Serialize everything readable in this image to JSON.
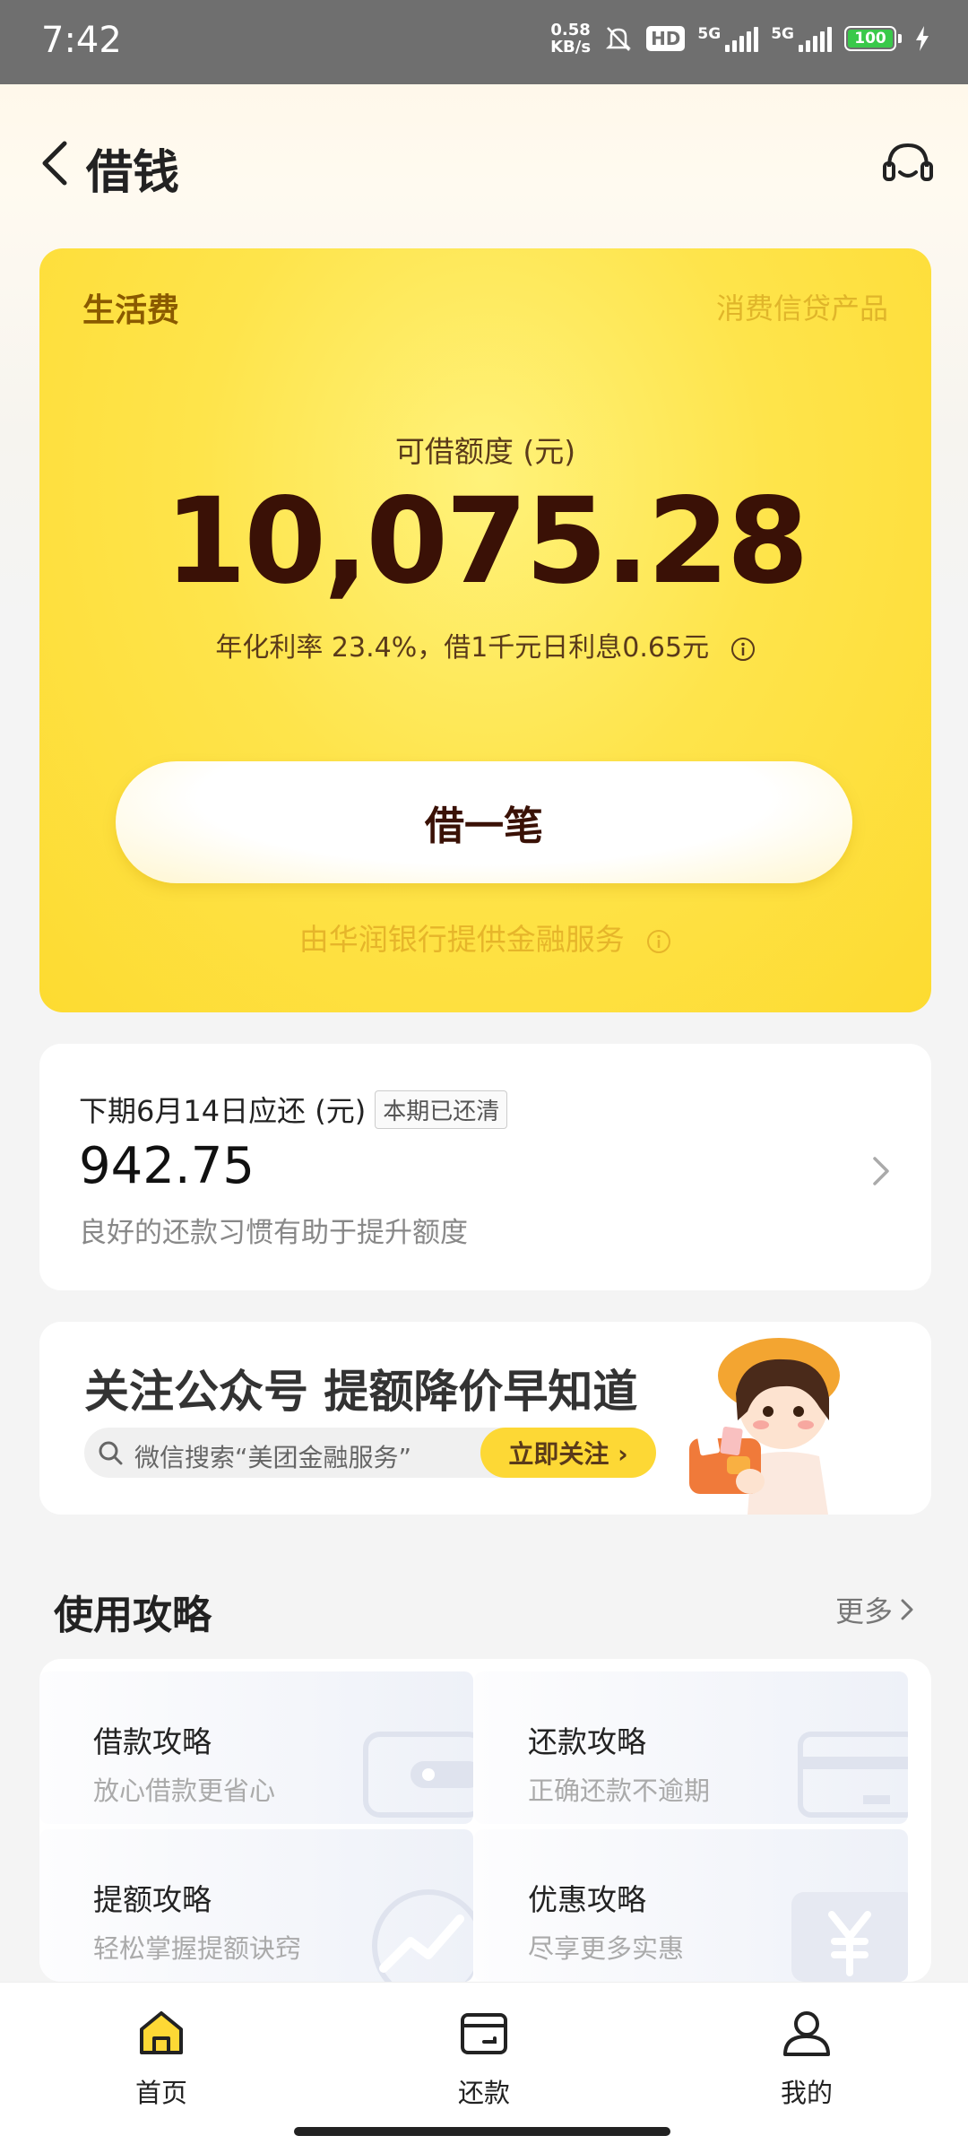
{
  "status_bar": {
    "time": "7:42",
    "net_speed_value": "0.58",
    "net_speed_unit": "KB/s",
    "hd_label": "HD",
    "sim1_label": "5G",
    "sim2_label": "5G",
    "battery": "100",
    "battery_color": "#39c94a"
  },
  "header": {
    "title": "借钱",
    "back_icon": "chevron-left-icon",
    "service_icon": "headset-icon"
  },
  "loan_card": {
    "label": "生活费",
    "product_type": "消费信贷产品",
    "quota_label": "可借额度 (元)",
    "quota_amount": "10,075.28",
    "rate_text": "年化利率 23.4%，借1千元日利息0.65元",
    "borrow_button": "借一笔",
    "bank_text": "由华润银行提供金融服务",
    "colors": {
      "card_yellow": "#fee44b",
      "amount_text": "#3a1106",
      "label_brown": "#8a5a00"
    }
  },
  "repayment": {
    "title": "下期6月14日应还 (元)",
    "badge": "本期已还清",
    "amount": "942.75",
    "tip": "良好的还款习惯有助于提升额度"
  },
  "banner": {
    "title": "关注公众号 提额降价早知道",
    "search_text": "微信搜索“美团金融服务”",
    "follow_button": "立即关注 ›"
  },
  "guide": {
    "title": "使用攻略",
    "more": "更多",
    "items": [
      {
        "title": "借款攻略",
        "subtitle": "放心借款更省心"
      },
      {
        "title": "还款攻略",
        "subtitle": "正确还款不逾期"
      },
      {
        "title": "提额攻略",
        "subtitle": "轻松掌握提额诀窍"
      },
      {
        "title": "优惠攻略",
        "subtitle": "尽享更多实惠"
      }
    ]
  },
  "bottom_nav": {
    "items": [
      {
        "label": "首页",
        "icon": "home-icon",
        "active": true
      },
      {
        "label": "还款",
        "icon": "wallet-icon",
        "active": false
      },
      {
        "label": "我的",
        "icon": "person-icon",
        "active": false
      }
    ],
    "active_color": "#fdd835"
  }
}
